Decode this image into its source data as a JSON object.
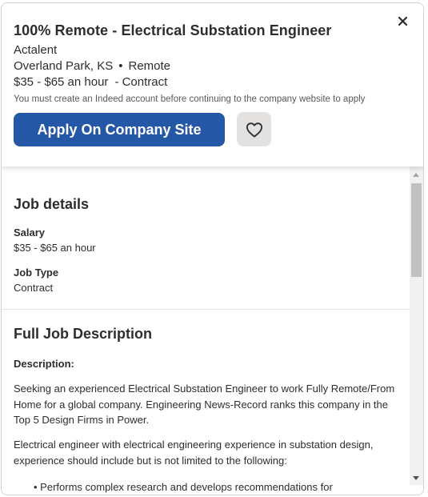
{
  "header": {
    "title": "100% Remote - Electrical Substation Engineer",
    "company": "Actalent",
    "location": "Overland Park, KS",
    "location_separator": "•",
    "work_mode": "Remote",
    "pay": "$35 - $65 an hour",
    "job_type_suffix": "- Contract",
    "notice": "You must create an Indeed account before continuing to the company website to apply",
    "apply_label": "Apply On Company Site",
    "close_glyph": "×"
  },
  "job_details": {
    "title": "Job details",
    "salary_label": "Salary",
    "salary_value": "$35 - $65 an hour",
    "type_label": "Job Type",
    "type_value": "Contract"
  },
  "description": {
    "title": "Full Job Description",
    "subheading": "Description:",
    "para1": "Seeking an experienced Electrical Substation Engineer to work Fully Remote/From Home for a global company. Engineering News-Record ranks this company in the Top 5 Design Firms in Power.",
    "para2": "Electrical engineer with electrical engineering experience in substation design, experience should include but is not limited to the following:",
    "bullet1": "Performs complex research and develops recommendations for"
  },
  "colors": {
    "accent": "#2557a7",
    "save_bg": "#e4e2e0"
  },
  "icons": {
    "close": "close-icon",
    "save": "heart-icon"
  }
}
